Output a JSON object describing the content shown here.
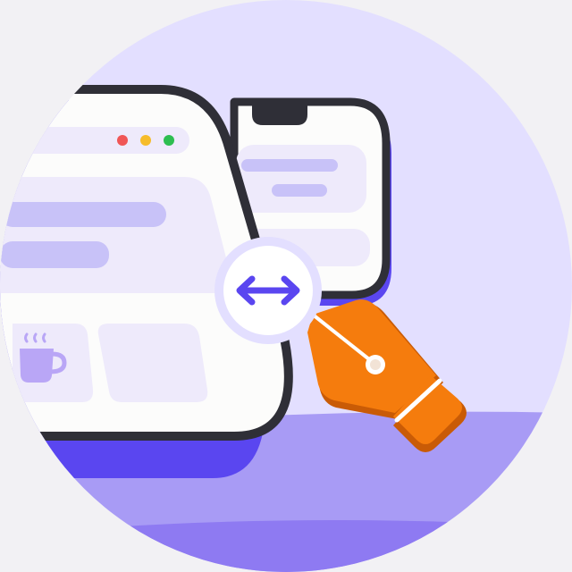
{
  "illustration": {
    "subject": "responsive-web-design",
    "colors": {
      "page_background": "#F2F1F4",
      "circle_background": "#E3DFFF",
      "floor": "#A89BF5",
      "floor_front": "#8E7AF2",
      "outline": "#2F2F37",
      "screen_fill": "#FCFCFB",
      "content_block": "#EEEAFB",
      "content_bar": "#C8C2F8",
      "shadow": "#5A46F0",
      "accent": "#5A46F0",
      "traffic_red": "#F05656",
      "traffic_yellow": "#F6BC2B",
      "traffic_green": "#2DBE50",
      "cup": "#B9A6F6",
      "pen": "#F57C0D",
      "pen_dark": "#C95B06"
    },
    "icons": {
      "resize": "double-arrow-horizontal-icon",
      "pen": "pen-nib-icon",
      "cup": "coffee-cup-icon",
      "window_controls": "traffic-light-icons"
    }
  }
}
